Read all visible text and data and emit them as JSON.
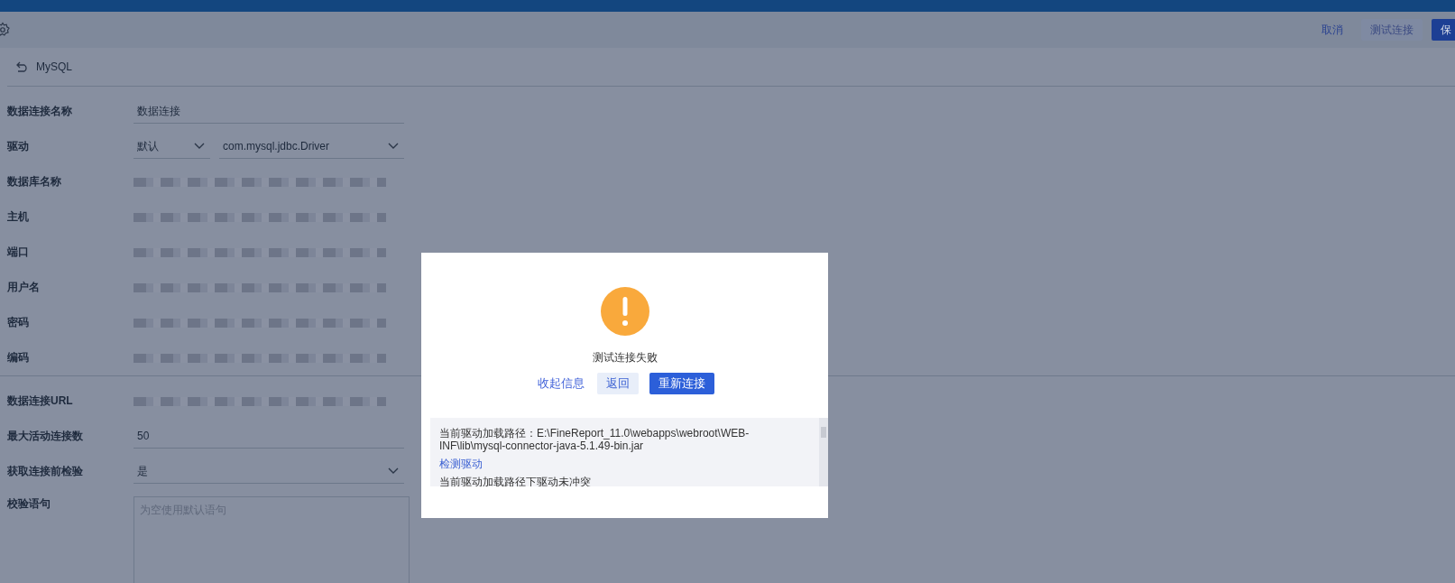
{
  "toolbar": {
    "buttons": [
      {
        "label": "取消",
        "kind": "link"
      },
      {
        "label": "测试连接",
        "kind": "secondary"
      },
      {
        "label": "保",
        "kind": "primary"
      }
    ]
  },
  "breadcrumb": {
    "title": "MySQL"
  },
  "form": {
    "sections": [
      {
        "fields": [
          {
            "label": "数据连接名称",
            "kind": "text",
            "value": "数据连接"
          },
          {
            "label": "驱动",
            "kind": "double-select",
            "value": "默认",
            "value_2": "com.mysql.jdbc.Driver"
          },
          {
            "label": "数据库名称",
            "kind": "redacted"
          },
          {
            "label": "主机",
            "kind": "redacted"
          },
          {
            "label": "端口",
            "kind": "redacted"
          },
          {
            "label": "用户名",
            "kind": "redacted"
          },
          {
            "label": "密码",
            "kind": "redacted"
          },
          {
            "label": "编码",
            "kind": "redacted"
          }
        ]
      },
      {
        "fields": [
          {
            "label": "数据连接URL",
            "kind": "redacted"
          },
          {
            "label": "最大活动连接数",
            "kind": "text",
            "value": "50"
          },
          {
            "label": "获取连接前检验",
            "kind": "select",
            "value": "是"
          },
          {
            "label": "校验语句",
            "kind": "textarea",
            "placeholder": "为空使用默认语句"
          }
        ]
      }
    ]
  },
  "dialog": {
    "message": "测试连接失败",
    "buttons": [
      {
        "label": "收起信息",
        "kind": "link"
      },
      {
        "label": "返回",
        "kind": "secondary"
      },
      {
        "label": "重新连接",
        "kind": "primary"
      }
    ],
    "details": [
      {
        "text": "当前驱动加载路径：E:\\FineReport_11.0\\webapps\\webroot\\WEB-INF\\lib\\mysql-connector-java-5.1.49-bin.jar",
        "kind": "text"
      },
      {
        "text": "检测驱动",
        "kind": "link"
      },
      {
        "text": "当前驱动加载路径下驱动未冲突",
        "kind": "text"
      }
    ]
  }
}
